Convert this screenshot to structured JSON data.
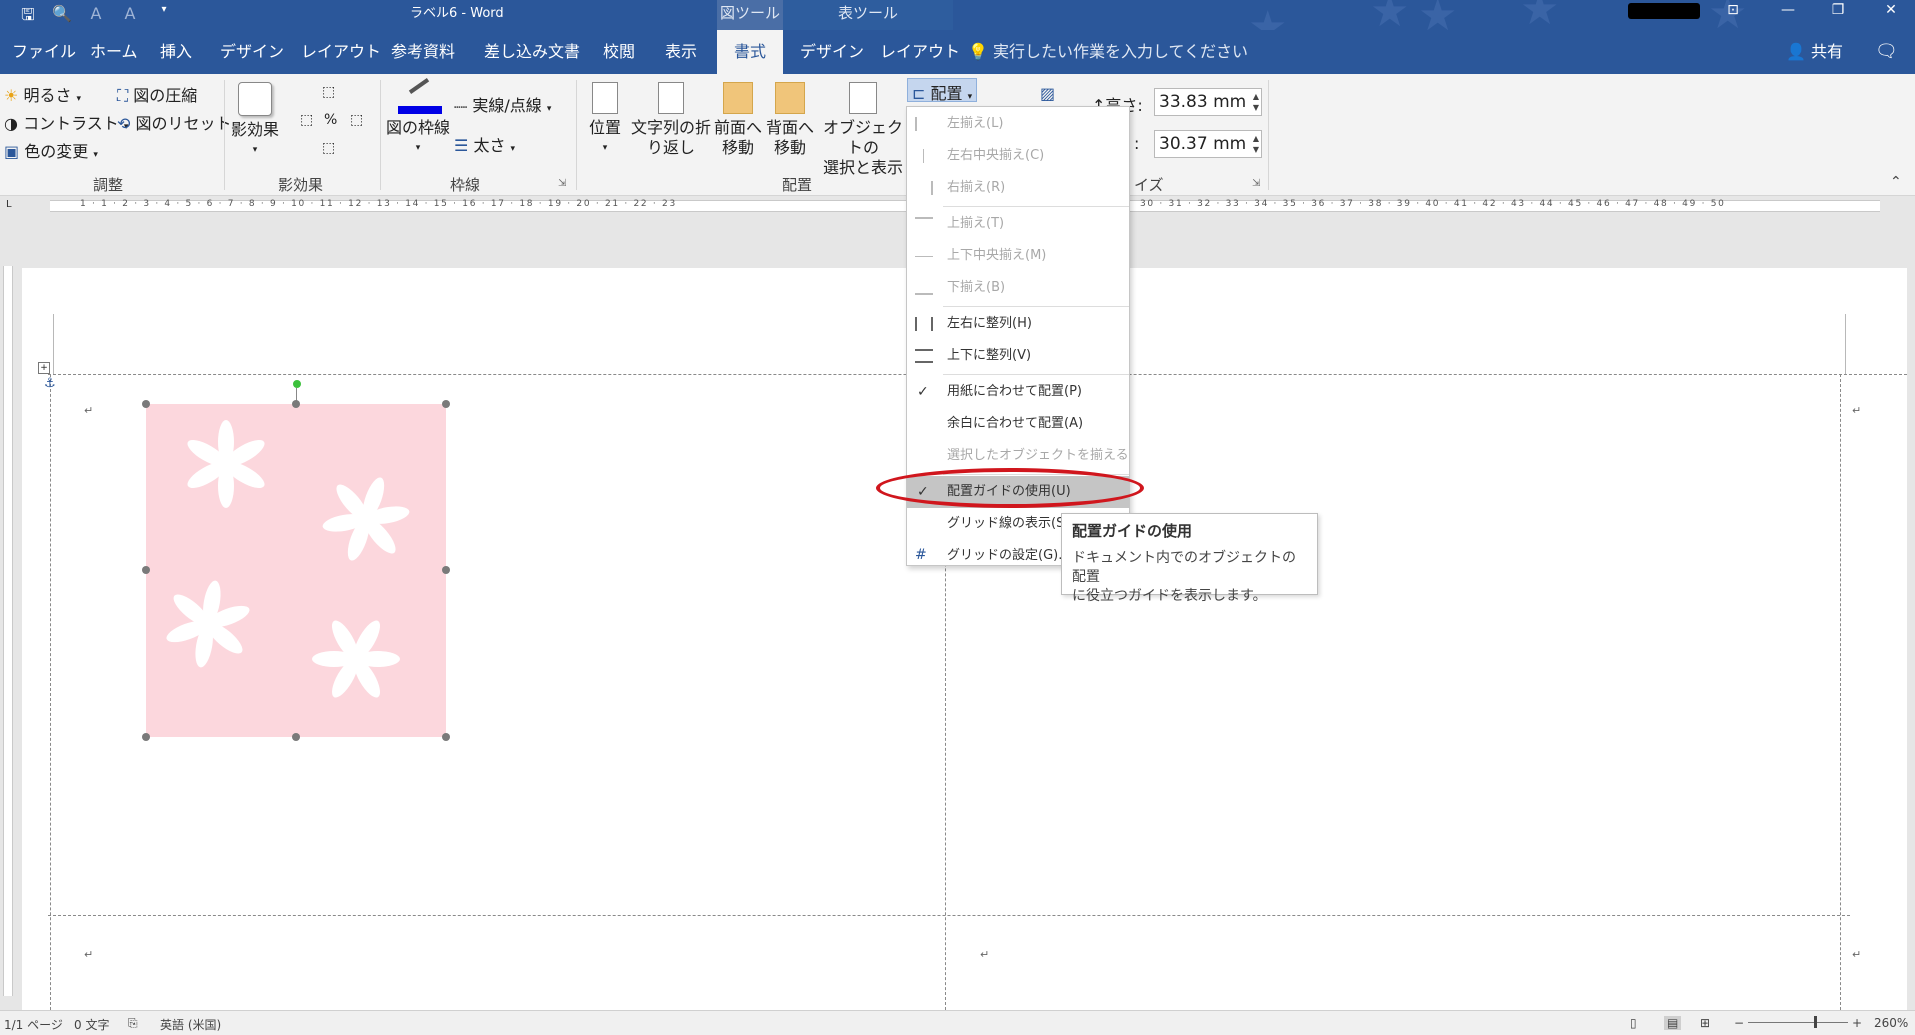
{
  "titlebar": {
    "title": "ラベル6 - Word",
    "contextual_picture_tools": "図ツール",
    "contextual_table_tools": "表ツール"
  },
  "tabs": [
    "ファイル",
    "ホーム",
    "挿入",
    "デザイン",
    "レイアウト",
    "参考資料",
    "差し込み文書",
    "校閲",
    "表示",
    "書式",
    "デザイン",
    "レイアウト"
  ],
  "active_tab": "書式",
  "tell_me": "実行したい作業を入力してください",
  "share": "共有",
  "ribbon": {
    "adjust": {
      "brightness": "明るさ",
      "contrast": "コントラスト",
      "color_change": "色の変更",
      "compress": "図の圧縮",
      "reset": "図のリセット",
      "label": "調整"
    },
    "effects": {
      "button": "影効果",
      "label": "影効果"
    },
    "border": {
      "frame": "図の枠線",
      "line_style": "実線/点線",
      "weight": "太さ",
      "label": "枠線"
    },
    "arrange": {
      "position": "位置",
      "wrap_l1": "文字列の折",
      "wrap_l2": "り返し",
      "front_l1": "前面へ",
      "front_l2": "移動",
      "back_l1": "背面へ",
      "back_l2": "移動",
      "select_l1": "オブジェクトの",
      "select_l2": "選択と表示",
      "align": "配置",
      "label": "配置"
    },
    "size": {
      "height_label": "高さ:",
      "height_value": "33.83 mm",
      "width_label": ":",
      "width_value": "30.37 mm",
      "label": "イズ"
    }
  },
  "ruler_numbers": "1 · 1 · 2 · 3 · 4 · 5 · 6 · 7 · 8 · 9 · 10 · 11 · 12 · 13 · 14 · 15 · 16 · 17 · 18 · 19 · 20 · 21 · 22 · 23",
  "ruler_numbers_right": "30 · 31 · 32 · 33 · 34 · 35 · 36 · 37 · 38 · 39 · 40 · 41 · 42 · 43 · 44 · 45 · 46 · 47 · 48 · 49 · 50",
  "align_menu": [
    {
      "label": "左揃え(L)",
      "disabled": true
    },
    {
      "label": "左右中央揃え(C)",
      "disabled": true
    },
    {
      "label": "右揃え(R)",
      "disabled": true
    },
    {
      "label": "上揃え(T)",
      "disabled": true
    },
    {
      "label": "上下中央揃え(M)",
      "disabled": true
    },
    {
      "label": "下揃え(B)",
      "disabled": true
    },
    {
      "label": "左右に整列(H)",
      "disabled": false
    },
    {
      "label": "上下に整列(V)",
      "disabled": false
    },
    {
      "label": "用紙に合わせて配置(P)",
      "checked": true
    },
    {
      "label": "余白に合わせて配置(A)",
      "checked": false
    },
    {
      "label": "選択したオブジェクトを揃える(O)",
      "disabled": true
    },
    {
      "label": "配置ガイドの使用(U)",
      "checked": true,
      "hover": true
    },
    {
      "label": "グリッド線の表示(S)",
      "checked": false
    },
    {
      "label": "グリッドの設定(G)...",
      "checked": false
    }
  ],
  "tooltip": {
    "title": "配置ガイドの使用",
    "line1": "ドキュメント内でのオブジェクトの配置",
    "line2": "に役立つガイドを表示します。"
  },
  "status": {
    "page": "1/1 ページ",
    "words": "0 文字",
    "language": "英語 (米国)",
    "zoom": "260%"
  },
  "colors": {
    "accent": "#2b579a",
    "highlight": "#d0161d",
    "picture_fill": "#fcd7dd"
  }
}
